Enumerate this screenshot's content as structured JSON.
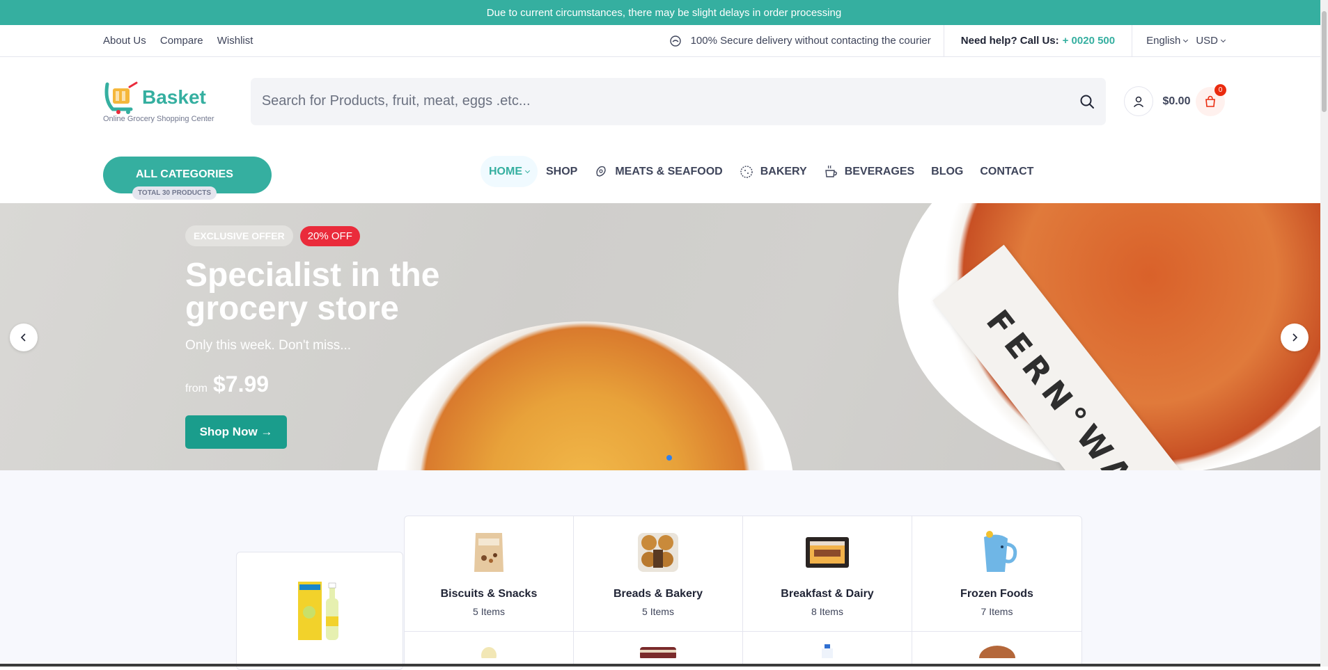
{
  "topbar": {
    "message": "Due to current circumstances, there may be slight delays in order processing"
  },
  "utility": {
    "links": [
      "About Us",
      "Compare",
      "Wishlist"
    ],
    "secure_text": "100% Secure delivery without contacting the courier",
    "help_label": "Need help? Call Us:",
    "help_number": "+ 0020 500",
    "language": "English",
    "currency": "USD"
  },
  "header": {
    "logo_name": "Basket",
    "logo_tagline": "Online Grocery Shopping Center",
    "search_placeholder": "Search for Products, fruit, meat, eggs .etc...",
    "cart_total": "$0.00",
    "cart_count": "0"
  },
  "nav": {
    "all_categories": "ALL CATEGORIES",
    "total_products": "TOTAL 30 PRODUCTS",
    "items": [
      "HOME",
      "SHOP",
      "MEATS & SEAFOOD",
      "BAKERY",
      "BEVERAGES",
      "BLOG",
      "CONTACT"
    ]
  },
  "hero": {
    "badge_offer": "EXCLUSIVE OFFER",
    "badge_discount": "20% OFF",
    "title": "Specialist in the grocery store",
    "subtitle": "Only this week. Don't miss...",
    "price_prefix": "from",
    "price": "$7.99",
    "cta": "Shop Now →",
    "card_text": "FERN°WAY."
  },
  "categories": [
    {
      "name": "Biscuits & Snacks",
      "items": "5 Items"
    },
    {
      "name": "Breads & Bakery",
      "items": "5 Items"
    },
    {
      "name": "Breakfast & Dairy",
      "items": "8 Items"
    },
    {
      "name": "Frozen Foods",
      "items": "7 Items"
    }
  ],
  "colors": {
    "brand": "#35afa0",
    "sale": "#ea2b3b",
    "cart_badge": "#ea2b0f"
  }
}
